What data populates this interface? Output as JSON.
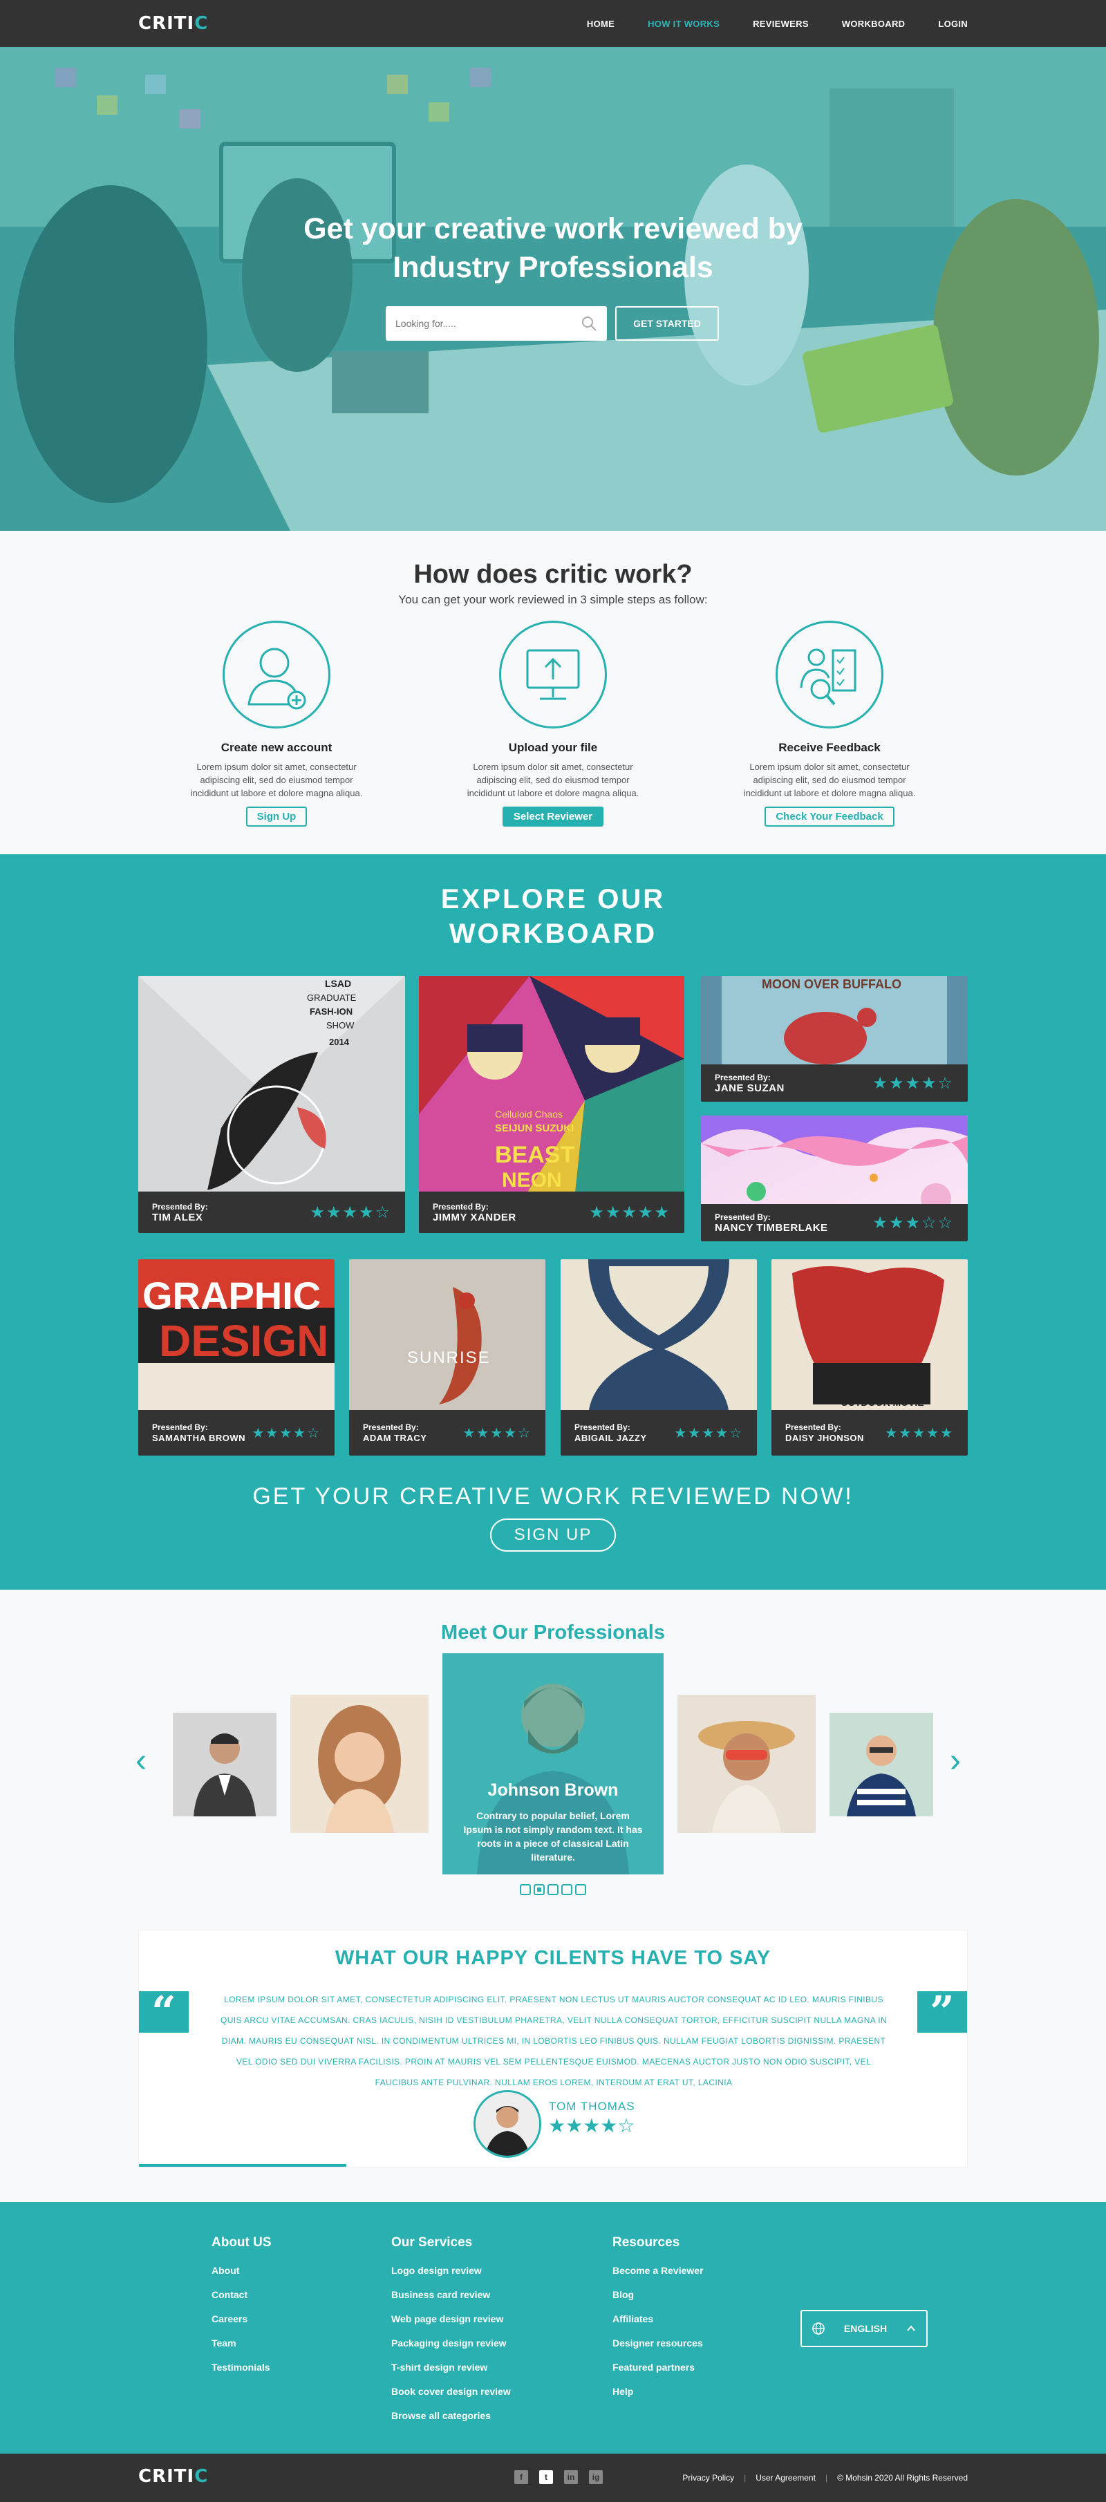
{
  "nav": {
    "logo": "CRITIC",
    "links": [
      "HOME",
      "HOW IT WORKS",
      "REVIEWERS",
      "WORKBOARD",
      "LOGIN"
    ]
  },
  "hero": {
    "title_line1": "Get your creative work reviewed by",
    "title_line2": "Industry Professionals",
    "search_placeholder": "Looking for.....",
    "cta": "GET STARTED"
  },
  "how": {
    "title": "How does critic work?",
    "subtitle": "You can get your work reviewed in 3 simple steps as follow:",
    "steps": [
      {
        "title": "Create new account",
        "text": "Lorem ipsum dolor sit amet, consectetur adipiscing elit, sed do eiusmod tempor incididunt ut labore et dolore magna aliqua.",
        "button": "Sign Up"
      },
      {
        "title": "Upload your file",
        "text": "Lorem ipsum dolor sit amet, consectetur adipiscing elit, sed do eiusmod tempor incididunt ut labore et dolore magna aliqua.",
        "button": "Select Reviewer"
      },
      {
        "title": "Receive Feedback",
        "text": "Lorem ipsum dolor sit amet, consectetur adipiscing elit, sed do eiusmod tempor incididunt ut labore et dolore magna aliqua.",
        "button": "Check Your Feedback"
      }
    ]
  },
  "workboard": {
    "title_line1": "EXPLORE OUR",
    "title_line2": "WORKBOARD",
    "presented_label": "Presented By:",
    "cards": [
      {
        "name": "TIM ALEX",
        "rating": 4,
        "art_text1": "LSAD",
        "art_text2": "GRADUATE",
        "art_text3": "FASH-ION",
        "art_text4": "SHOW",
        "art_text5": "2014"
      },
      {
        "name": "JIMMY XANDER",
        "rating": 5,
        "art_text1": "Celluloid Chaos",
        "art_text2": "SEIJUN SUZUKI",
        "art_text3": "BEAST",
        "art_text4": "NEON"
      },
      {
        "name": "JANE SUZAN",
        "rating": 4,
        "art_text1": "MOON OVER BUFFALO"
      },
      {
        "name": "NANCY TIMBERLAKE",
        "rating": 3
      },
      {
        "name": "SAMANTHA BROWN",
        "rating": 4,
        "art_text1": "GRAPHIC",
        "art_text2": "DESIGN"
      },
      {
        "name": "ADAM TRACY",
        "rating": 4,
        "art_text1": "SUNRISE"
      },
      {
        "name": "ABIGAIL JAZZY",
        "rating": 4
      },
      {
        "name": "DAISY JHONSON",
        "rating": 5,
        "art_text1": "OUTDOOR MOVIE"
      }
    ],
    "cta": "GET YOUR CREATIVE WORK REVIEWED NOW!",
    "cta_button": "SIGN UP"
  },
  "professionals": {
    "title": "Meet Our Professionals",
    "featured_name": "Johnson Brown",
    "featured_bio": "Contrary to popular belief, Lorem Ipsum is not simply random text. It has roots in a piece of classical Latin literature.",
    "active_dot": 2
  },
  "testimonials": {
    "title": "WHAT OUR HAPPY CILENTS HAVE TO SAY",
    "quote_text": "LOREM IPSUM DOLOR SIT AMET, CONSECTETUR ADIPISCING ELIT. PRAESENT NON LECTUS UT MAURIS AUCTOR CONSEQUAT AC ID LEO. MAURIS FINIBUS QUIS ARCU VITAE ACCUMSAN. CRAS IACULIS, NISIH ID VESTIBULUM PHARETRA, VELIT NULLA CONSEQUAT TORTOR, EFFICITUR SUSCIPIT NULLA MAGNA IN DIAM. MAURIS EU CONSEQUAT NISL. IN CONDIMENTUM ULTRICES MI, IN LOBORTIS LEO FINIBUS QUIS. NULLAM FEUGIAT LOBORTIS DIGNISSIM. PRAESENT VEL ODIO SED DUI VIVERRA FACILISIS. PROIN AT MAURIS VEL SEM PELLENTESQUE EUISMOD. MAECENAS AUCTOR JUSTO NON ODIO SUSCIPIT, VEL FAUCIBUS ANTE PULVINAR. NULLAM EROS LOREM, INTERDUM AT ERAT UT, LACINIA",
    "author": "TOM THOMAS",
    "rating": 4,
    "progress": 0.25
  },
  "footer": {
    "col1_title": "About US",
    "col1_links": [
      "About",
      "Contact",
      "Careers",
      "Team",
      "Testimonials"
    ],
    "col2_title": "Our Services",
    "col2_links": [
      "Logo design review",
      "Business card review",
      "Web page design review",
      "Packaging design review",
      "T-shirt design review",
      "Book cover design review",
      "Browse all categories"
    ],
    "col3_title": "Resources",
    "col3_links": [
      "Become a Reviewer",
      "Blog",
      "Affiliates",
      "Designer resources",
      "Featured partners",
      "Help"
    ],
    "language": "ENGLISH"
  },
  "bottom": {
    "logo": "CRITIC",
    "social": [
      "f",
      "t",
      "in",
      "ig"
    ],
    "privacy": "Privacy Policy",
    "user_agreement": "User Agreement",
    "copyright": "© Mohsin 2020 All Rights Reserved"
  },
  "colors": {
    "accent": "#26b0b0",
    "dark": "#333333"
  }
}
